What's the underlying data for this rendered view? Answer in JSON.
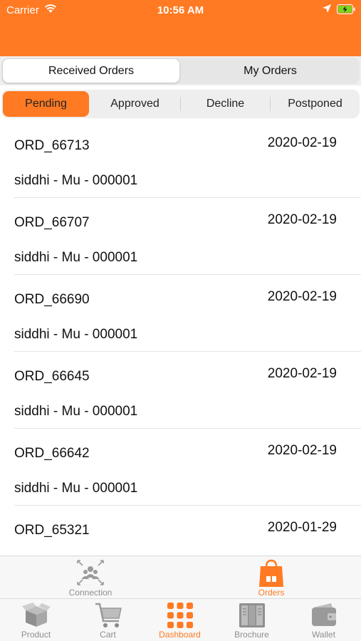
{
  "status": {
    "carrier": "Carrier",
    "time": "10:56 AM"
  },
  "segments": {
    "received": "Received Orders",
    "mine": "My Orders"
  },
  "tabs": [
    "Pending",
    "Approved",
    "Decline",
    "Postponed"
  ],
  "orders": [
    {
      "id": "ORD_66713",
      "date": "2020-02-19",
      "detail": "siddhi - Mu - 000001"
    },
    {
      "id": "ORD_66707",
      "date": "2020-02-19",
      "detail": "siddhi - Mu - 000001"
    },
    {
      "id": "ORD_66690",
      "date": "2020-02-19",
      "detail": "siddhi - Mu - 000001"
    },
    {
      "id": "ORD_66645",
      "date": "2020-02-19",
      "detail": "siddhi - Mu - 000001"
    },
    {
      "id": "ORD_66642",
      "date": "2020-02-19",
      "detail": "siddhi - Mu - 000001"
    },
    {
      "id": "ORD_65321",
      "date": "2020-01-29",
      "detail": ""
    }
  ],
  "tabbar_top": [
    {
      "label": "Connection",
      "icon": "connection-icon"
    },
    {
      "label": "Orders",
      "icon": "orders-bag-icon",
      "active": true
    }
  ],
  "tabbar_bottom": [
    {
      "label": "Product",
      "icon": "product-box-icon"
    },
    {
      "label": "Cart",
      "icon": "cart-icon"
    },
    {
      "label": "Dashboard",
      "icon": "dashboard-grid-icon",
      "active": true
    },
    {
      "label": "Brochure",
      "icon": "brochure-icon"
    },
    {
      "label": "Wallet",
      "icon": "wallet-icon"
    }
  ],
  "colors": {
    "accent": "#ff7a22",
    "inactive": "#8e8e8e"
  }
}
